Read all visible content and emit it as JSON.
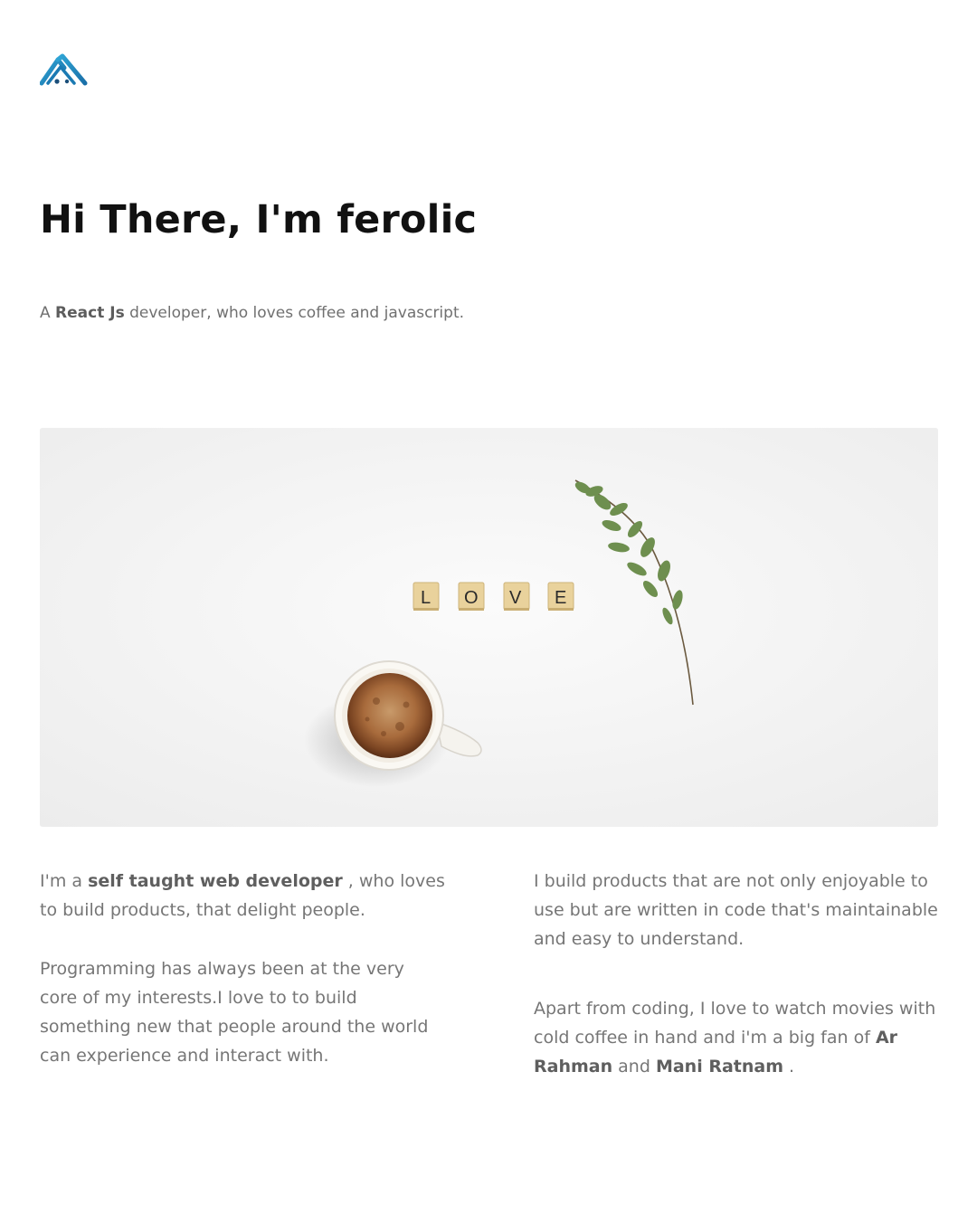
{
  "header": {
    "logo_icon": "mountain-logo-icon",
    "brand_color": "#1f88c2"
  },
  "hero": {
    "title": "Hi There, I'm ferolic",
    "tagline": {
      "prefix": "A ",
      "highlight": "React Js",
      "suffix": " developer, who loves coffee and javascript."
    },
    "image": {
      "tiles": [
        "L",
        "O",
        "V",
        "E"
      ]
    }
  },
  "about": {
    "left": {
      "p1": {
        "prefix": "I'm a ",
        "highlight": "self taught web developer",
        "suffix": " , who loves to build products, that delight people."
      },
      "p2": "Programming has always been at the very core of my interests.I love to to build something new that people around the world can experience and interact with."
    },
    "right": {
      "p1": "I build products that are not only enjoyable to use but are written in code that's maintainable and easy to understand.",
      "p2": {
        "prefix": "Apart from coding, I love to watch movies with cold coffee in hand and i'm a big fan of ",
        "name1": "Ar Rahman",
        "middle": " and ",
        "name2": "Mani Ratnam",
        "suffix": " ."
      }
    }
  }
}
